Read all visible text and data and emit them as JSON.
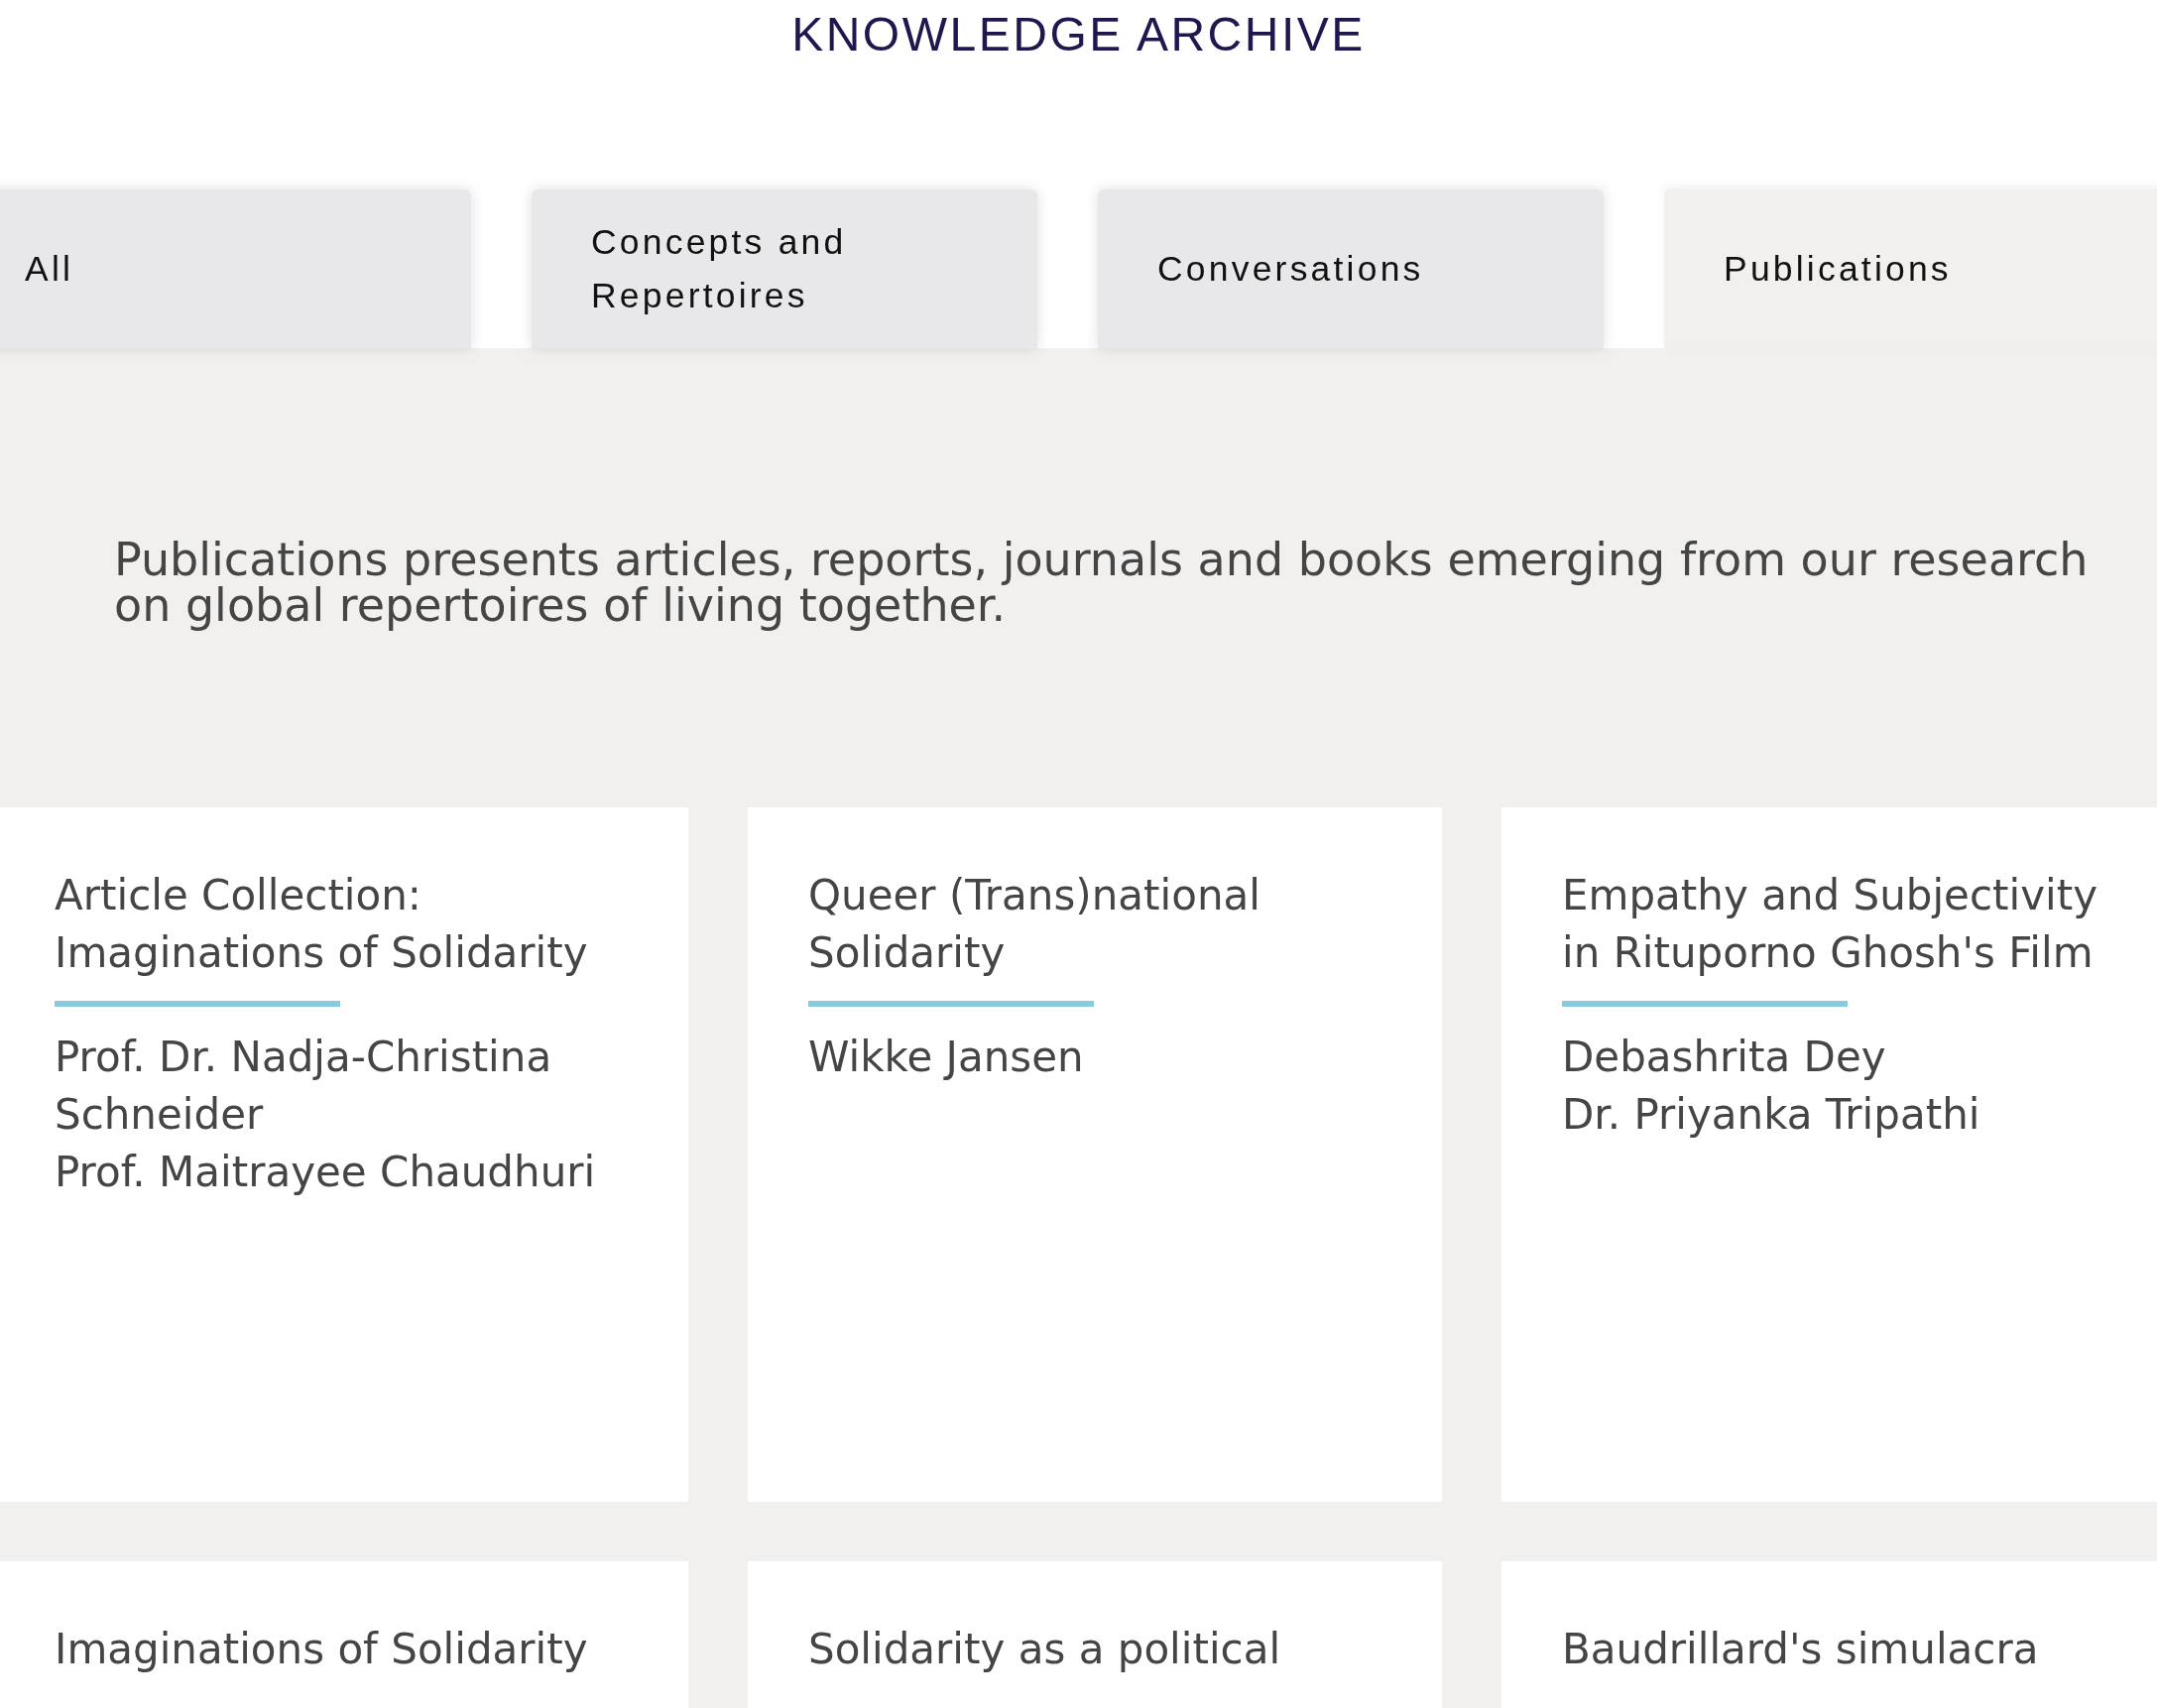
{
  "header": {
    "title": "KNOWLEDGE ARCHIVE"
  },
  "tabs": [
    {
      "label": "All",
      "selected": false
    },
    {
      "label": "Concepts and Repertoires",
      "selected": false
    },
    {
      "label": "Conversations",
      "selected": false
    },
    {
      "label": "Publications",
      "selected": true
    }
  ],
  "intro": {
    "text": "Publications presents articles, reports, journals and books emerging from our research on global repertoires of living together."
  },
  "publications": [
    {
      "title": "Article Collection: Imaginations of Solidarity",
      "authors": [
        "Prof. Dr. Nadja-Christina Schneider",
        "Prof. Maitrayee Chaudhuri"
      ]
    },
    {
      "title": "Queer (Trans)national Solidarity",
      "authors": [
        "Wikke Jansen"
      ]
    },
    {
      "title": "Empathy and Subjectivity in Rituporno Ghosh's Film",
      "authors": [
        "Debashrita Dey",
        "Dr. Priyanka Tripathi"
      ]
    },
    {
      "title": "Imaginations of Solidarity"
    },
    {
      "title": "Solidarity as a political"
    },
    {
      "title": "Baudrillard's simulacra"
    }
  ]
}
